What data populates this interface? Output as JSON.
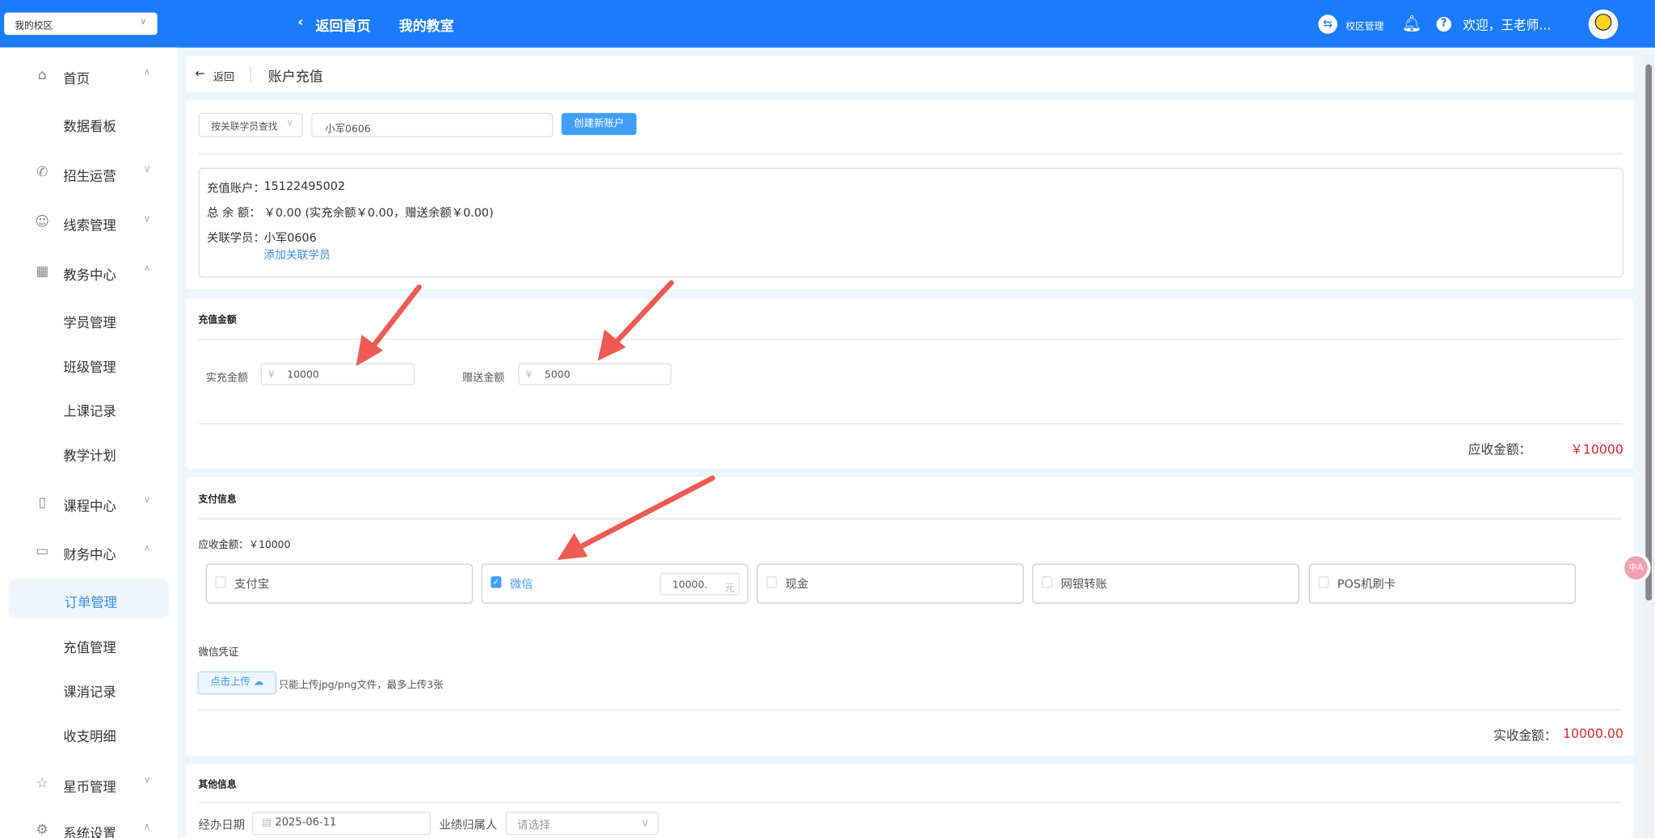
{
  "header": {
    "campus_select": "我的校区",
    "back_home": "返回首页",
    "my_classroom": "我的教室",
    "campus_manage": "校区管理",
    "welcome": "欢迎，王老师..."
  },
  "sidebar": {
    "items": [
      {
        "label": "首页",
        "icon": "home-icon",
        "arrow": "up"
      },
      {
        "label": "数据看板",
        "sub": true
      },
      {
        "label": "招生运营",
        "icon": "phone-icon",
        "arrow": "down"
      },
      {
        "label": "线索管理",
        "icon": "user-icon",
        "arrow": "down"
      },
      {
        "label": "教务中心",
        "icon": "building-icon",
        "arrow": "up"
      },
      {
        "label": "学员管理",
        "sub": true
      },
      {
        "label": "班级管理",
        "sub": true
      },
      {
        "label": "上课记录",
        "sub": true
      },
      {
        "label": "教学计划",
        "sub": true
      },
      {
        "label": "课程中心",
        "icon": "book-icon",
        "arrow": "down"
      },
      {
        "label": "财务中心",
        "icon": "card-icon",
        "arrow": "up"
      },
      {
        "label": "订单管理",
        "sub": true,
        "active": true
      },
      {
        "label": "充值管理",
        "sub": true
      },
      {
        "label": "课消记录",
        "sub": true
      },
      {
        "label": "收支明细",
        "sub": true
      },
      {
        "label": "星币管理",
        "icon": "star-icon",
        "arrow": "down"
      },
      {
        "label": "系统设置",
        "icon": "gear-icon",
        "arrow": "up"
      }
    ]
  },
  "page": {
    "back": "返回",
    "title": "账户充值"
  },
  "search": {
    "mode": "按关联学员查找",
    "value": "小军0606",
    "create_button": "创建新账户"
  },
  "account": {
    "account_label": "充值账户：",
    "account_value": "15122495002",
    "balance_label": "总 余 额：",
    "balance_value": "￥0.00 (实充余额￥0.00，赠送余额￥0.00)",
    "student_label": "关联学员：",
    "student_value": "小军0606",
    "add_student": "添加关联学员"
  },
  "recharge": {
    "title": "充值金额",
    "actual_label": "实充金额",
    "actual_value": "10000",
    "gift_label": "赠送金额",
    "gift_value": "5000",
    "currency": "¥",
    "due_label": "应收金额：",
    "due_value": "￥10000"
  },
  "payment": {
    "title": "支付信息",
    "due": "应收金额：￥10000",
    "methods": [
      {
        "label": "支付宝",
        "checked": false
      },
      {
        "label": "微信",
        "checked": true,
        "amount": "10000.",
        "unit": "元"
      },
      {
        "label": "现金",
        "checked": false
      },
      {
        "label": "网银转账",
        "checked": false
      },
      {
        "label": "POS机刷卡",
        "checked": false
      }
    ],
    "voucher_label": "微信凭证",
    "upload_button": "点击上传",
    "upload_hint": "只能上传jpg/png文件，最多上传3张",
    "received_label": "实收金额：",
    "received_value": "10000.00"
  },
  "other": {
    "title": "其他信息",
    "date_label": "经办日期",
    "date_value": "2025-06-11",
    "owner_label": "业绩归属人",
    "owner_placeholder": "请选择"
  },
  "colors": {
    "header": "#1a7bff",
    "primary": "#409eff",
    "amount_red": "#d8262b",
    "arrow": "#ef5b52"
  }
}
